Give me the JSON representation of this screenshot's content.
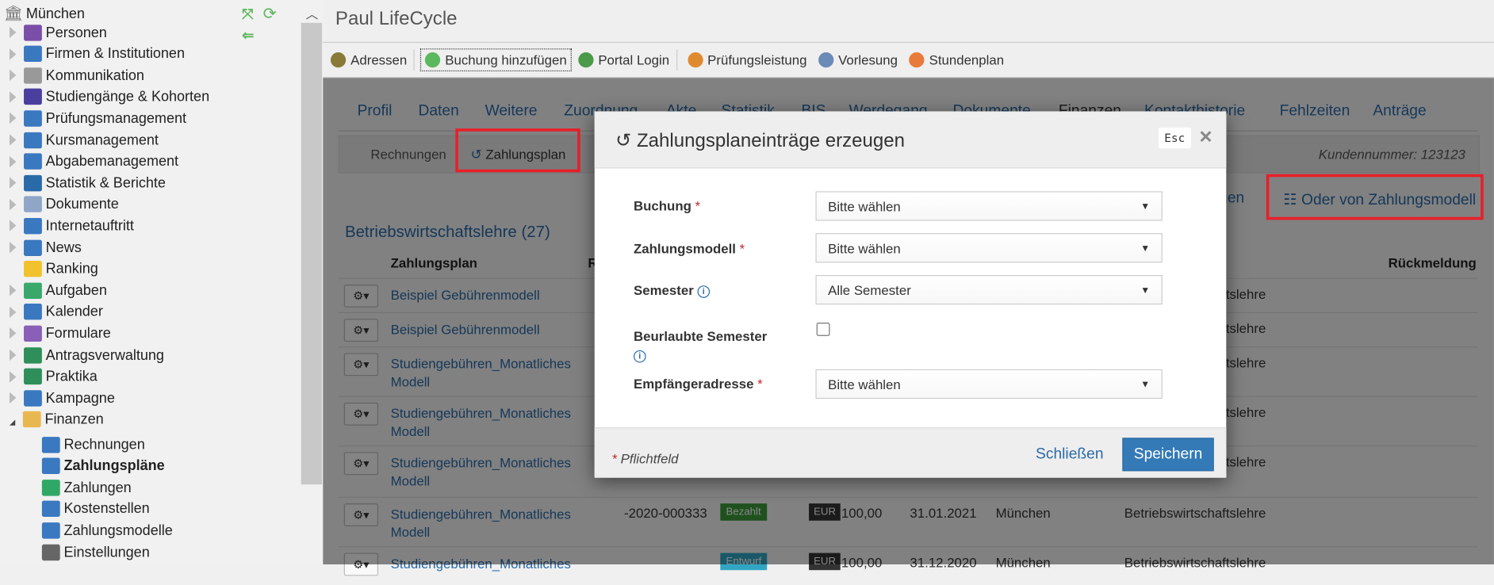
{
  "app": {
    "title": "Paul LifeCycle"
  },
  "sidebar": {
    "root": "München",
    "items": [
      {
        "label": "Personen",
        "icon": "persons-icon",
        "color": "#7b4fa8"
      },
      {
        "label": "Firmen & Institutionen",
        "icon": "factory-icon",
        "color": "#3a78c0"
      },
      {
        "label": "Kommunikation",
        "icon": "envelope-icon",
        "color": "#999999"
      },
      {
        "label": "Studiengänge & Kohorten",
        "icon": "graduation-cap-icon",
        "color": "#4a3f9e"
      },
      {
        "label": "Prüfungsmanagement",
        "icon": "exam-notebook-icon",
        "color": "#3a78c0"
      },
      {
        "label": "Kursmanagement",
        "icon": "book-icon",
        "color": "#3a78c0"
      },
      {
        "label": "Abgabemanagement",
        "icon": "id-card-icon",
        "color": "#3a78c0"
      },
      {
        "label": "Statistik & Berichte",
        "icon": "bar-chart-icon",
        "color": "#2a6aa8"
      },
      {
        "label": "Dokumente",
        "icon": "folder-icon",
        "color": "#8fa6c8"
      },
      {
        "label": "Internetauftritt",
        "icon": "globe-icon",
        "color": "#3a78c0"
      },
      {
        "label": "News",
        "icon": "info-icon",
        "color": "#3a78c0"
      },
      {
        "label": "Ranking",
        "icon": "star-medal-icon",
        "color": "#f2c12e"
      },
      {
        "label": "Aufgaben",
        "icon": "clock-icon",
        "color": "#3aa86b"
      },
      {
        "label": "Kalender",
        "icon": "calendar-icon",
        "color": "#3a78c0"
      },
      {
        "label": "Formulare",
        "icon": "form-wand-icon",
        "color": "#8a5fb8"
      },
      {
        "label": "Antragsverwaltung",
        "icon": "table-user-icon",
        "color": "#2f8f5a"
      },
      {
        "label": "Praktika",
        "icon": "table-user-icon",
        "color": "#2f8f5a"
      },
      {
        "label": "Kampagne",
        "icon": "gift-icon",
        "color": "#3a78c0"
      },
      {
        "label": "Finanzen",
        "icon": "coins-icon",
        "color": "#e8b850"
      }
    ],
    "finanzen_children": [
      {
        "label": "Rechnungen",
        "icon": "invoice-search-icon",
        "color": "#3a78c0"
      },
      {
        "label": "Zahlungspläne",
        "icon": "invoice-search-icon",
        "color": "#3a78c0",
        "active": true
      },
      {
        "label": "Zahlungen",
        "icon": "banknote-icon",
        "color": "#2fa866"
      },
      {
        "label": "Kostenstellen",
        "icon": "factory-icon",
        "color": "#3a78c0"
      },
      {
        "label": "Zahlungsmodelle",
        "icon": "calculator-icon",
        "color": "#3a78c0"
      },
      {
        "label": "Einstellungen",
        "icon": "gear-icon",
        "color": "#666666"
      }
    ]
  },
  "toolbar": [
    {
      "label": "Adressen",
      "icon": "address-book-icon",
      "color": "#8a7a3a"
    },
    {
      "label": "Buchung hinzufügen",
      "icon": "plus-circle-icon",
      "color": "#5cb85c"
    },
    {
      "label": "Portal Login",
      "icon": "globe-login-icon",
      "color": "#4a9a4a"
    },
    {
      "label": "Prüfungsleistung",
      "icon": "pencil-chart-icon",
      "color": "#e08a30"
    },
    {
      "label": "Vorlesung",
      "icon": "lecture-icon",
      "color": "#6a8ab8"
    },
    {
      "label": "Stundenplan",
      "icon": "timetable-icon",
      "color": "#e87a3a"
    }
  ],
  "tabs": [
    "Profil",
    "Daten",
    "Weitere",
    "Zuordnung",
    "Akte",
    "Statistik",
    "BIS",
    "Werdegang",
    "Dokumente",
    "Finanzen",
    "Kontakthistorie",
    "Fehlzeiten",
    "Anträge"
  ],
  "subtabs": {
    "rechnungen": "Rechnungen",
    "zahlungsplan": "Zahlungsplan",
    "kundennummer": "Kundennummer: 123123"
  },
  "actions": {
    "add_partial": "fügen",
    "from_model": "Oder von Zahlungsmodell"
  },
  "section_title": "Betriebswirtschaftslehre (27)",
  "table": {
    "headers": {
      "zahlungsplan": "Zahlungsplan",
      "r": "R",
      "last": "Rückmeldung"
    },
    "rows": [
      {
        "name": "Beispiel Gebühren­modell",
        "num": "-",
        "course": "Betriebswirtschaftslehre"
      },
      {
        "name": "Beispiel Gebührenmodell",
        "num": "-",
        "course": "Betriebswirtschaftslehre"
      },
      {
        "name": "Studiengebühren_Monatliches Modell",
        "course": "Betriebswirtschaftslehre"
      },
      {
        "name": "Studiengebühren_Monatliches Modell",
        "course": "Betriebswirtschaftslehre"
      },
      {
        "name": "Studiengebühren_Monatliches Modell",
        "course": "Betriebswirtschaftslehre"
      },
      {
        "name": "Studiengebühren_Monatliches Modell",
        "num": "-2020-000333",
        "status": "Bezahlt",
        "status_color": "#3c9a3c",
        "currency": "EUR",
        "amount": "100,00",
        "date": "31.01.2021",
        "city": "München",
        "course": "Betriebswirtschaftslehre"
      },
      {
        "name": "Studiengebühren_Monatliches",
        "status": "Entwurf",
        "status_color": "#31a6c4",
        "currency": "EUR",
        "amount": "100,00",
        "date": "31.12.2020",
        "city": "München",
        "course": "Betriebswirtschaftslehre"
      }
    ]
  },
  "modal": {
    "title": "Zahlungsplaneinträge erzeugen",
    "esc": "Esc",
    "fields": {
      "buchung": {
        "label": "Buchung",
        "value": "Bitte wählen"
      },
      "zahlungsmodell": {
        "label": "Zahlungsmodell",
        "value": "Bitte wählen"
      },
      "semester": {
        "label": "Semester",
        "value": "Alle Semester"
      },
      "beurlaubt": {
        "label": "Beurlaubte Semester",
        "checked": false
      },
      "empfaenger": {
        "label": "Empfängeradresse",
        "value": "Bitte wählen"
      }
    },
    "required_mark": "*",
    "required_note": "Pflichtfeld",
    "close": "Schließen",
    "save": "Speichern"
  },
  "colors": {
    "accent": "#337ab7",
    "link": "#2a6aa8",
    "highlight": "#e8202a"
  }
}
